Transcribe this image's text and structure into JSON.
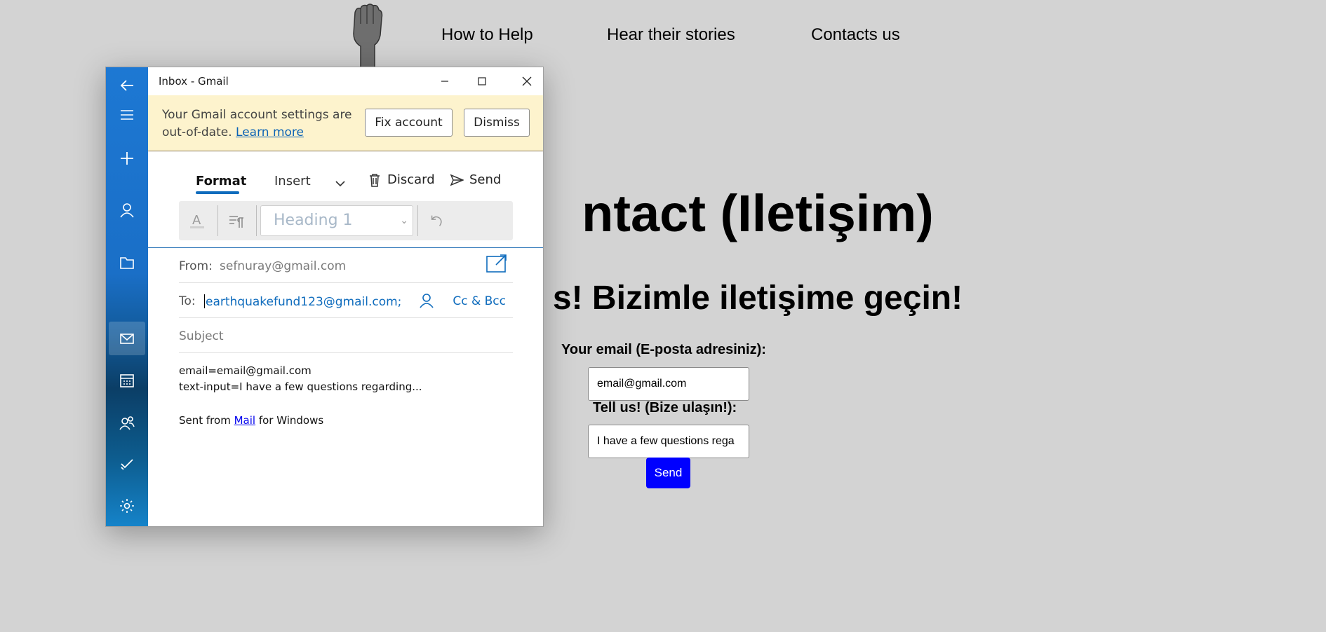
{
  "webpage": {
    "nav": [
      "How to Help",
      "Hear their stories",
      "Contacts us"
    ],
    "title": "ntact (Iletişim)",
    "subtitle": "s! Bizimle iletişime geçin!",
    "email_label": "Your email (E-posta adresiniz):",
    "email_value": "email@gmail.com",
    "message_label": "Tell us! (Bize ulaşın!):",
    "message_value": "I have a few questions rega",
    "send_label": "Send"
  },
  "mail": {
    "window_title": "Inbox - Gmail",
    "banner": {
      "message": "Your Gmail account settings are out-of-date.",
      "link": "Learn more",
      "fix_label": "Fix account",
      "dismiss_label": "Dismiss"
    },
    "tabs": {
      "format": "Format",
      "insert": "Insert"
    },
    "actions": {
      "discard": "Discard",
      "send": "Send"
    },
    "format_bar": {
      "style_value": "Heading 1"
    },
    "from": {
      "label": "From:",
      "value": "sefnuray@gmail.com"
    },
    "to": {
      "label": "To:",
      "value": "earthquakefund123@gmail.com;",
      "cc_bcc": "Cc & Bcc"
    },
    "subject_placeholder": "Subject",
    "body": {
      "line1": "email=email@gmail.com",
      "line2": "text-input=I have a few questions regarding...",
      "sent_prefix": "Sent from ",
      "sent_link": "Mail",
      "sent_suffix": " for Windows"
    },
    "rail_icons": [
      "back-arrow-icon",
      "hamburger-menu-icon",
      "new-mail-plus-icon",
      "account-icon",
      "folder-icon",
      "mail-icon",
      "calendar-icon",
      "people-icon",
      "todo-icon",
      "settings-gear-icon"
    ]
  },
  "colors": {
    "accent": "#0f6cbd",
    "banner_bg": "#fdf3cd",
    "page_bg": "#d3d3d3",
    "send_button": "#0000ff"
  }
}
